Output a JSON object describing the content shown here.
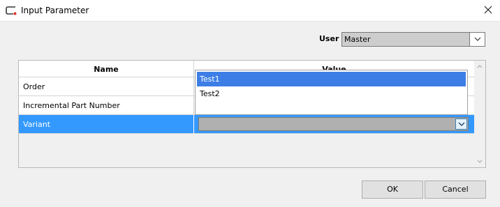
{
  "window": {
    "title": "Input Parameter"
  },
  "user": {
    "label": "User",
    "value": "Master"
  },
  "grid": {
    "headers": {
      "name": "Name",
      "value": "Value"
    },
    "rows": [
      {
        "name": "Order"
      },
      {
        "name": "Incremental Part Number"
      },
      {
        "name": "Variant",
        "selected": true
      }
    ]
  },
  "dropdown": {
    "options": [
      "Test1",
      "Test2"
    ],
    "highlighted": "Test1"
  },
  "buttons": {
    "ok": "OK",
    "cancel": "Cancel"
  },
  "colors": {
    "selection": "#3399ff",
    "dropdown_highlight": "#3d7ee6",
    "icon_accent": "#e0322b"
  },
  "icons": [
    "app-icon",
    "close-icon",
    "chevron-down-icon",
    "scroll-up-icon",
    "scroll-down-icon"
  ]
}
